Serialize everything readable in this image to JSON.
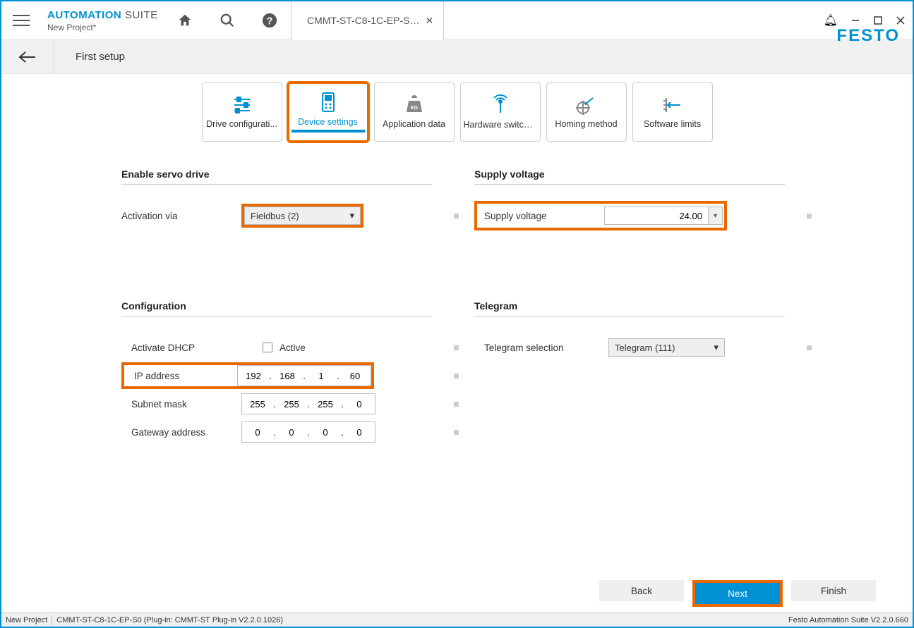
{
  "header": {
    "app_name_a": "AUTOMATION",
    "app_name_b": "SUITE",
    "subtitle": "New Project*",
    "tab_label": "CMMT-ST-C8-1C-EP-S…",
    "brand": "FESTO"
  },
  "breadcrumb": {
    "label": "First setup"
  },
  "steps": [
    {
      "id": "drive-config",
      "label": "Drive configurati..."
    },
    {
      "id": "device-settings",
      "label": "Device settings",
      "active": true
    },
    {
      "id": "app-data",
      "label": "Application data"
    },
    {
      "id": "hw-switches",
      "label": "Hardware switches"
    },
    {
      "id": "homing",
      "label": "Homing method"
    },
    {
      "id": "sw-limits",
      "label": "Software limits"
    }
  ],
  "sections": {
    "enable_servo": {
      "title": "Enable servo drive",
      "activation_label": "Activation via",
      "activation_value": "Fieldbus (2)"
    },
    "supply": {
      "title": "Supply voltage",
      "label": "Supply voltage",
      "value": "24.00"
    },
    "config": {
      "title": "Configuration",
      "dhcp_label": "Activate DHCP",
      "dhcp_active_label": "Active",
      "ip_label": "IP address",
      "ip_octets": [
        "192",
        "168",
        "1",
        "60"
      ],
      "subnet_label": "Subnet mask",
      "subnet_octets": [
        "255",
        "255",
        "255",
        "0"
      ],
      "gateway_label": "Gateway address",
      "gateway_octets": [
        "0",
        "0",
        "0",
        "0"
      ]
    },
    "telegram": {
      "title": "Telegram",
      "label": "Telegram selection",
      "value": "Telegram (111)"
    }
  },
  "buttons": {
    "back": "Back",
    "next": "Next",
    "finish": "Finish"
  },
  "statusbar": {
    "left1": "New Project",
    "left2": "CMMT-ST-C8-1C-EP-S0 (Plug-in: CMMT-ST Plug-in V2.2.0.1026)",
    "right": "Festo Automation Suite V2.2.0.660"
  }
}
